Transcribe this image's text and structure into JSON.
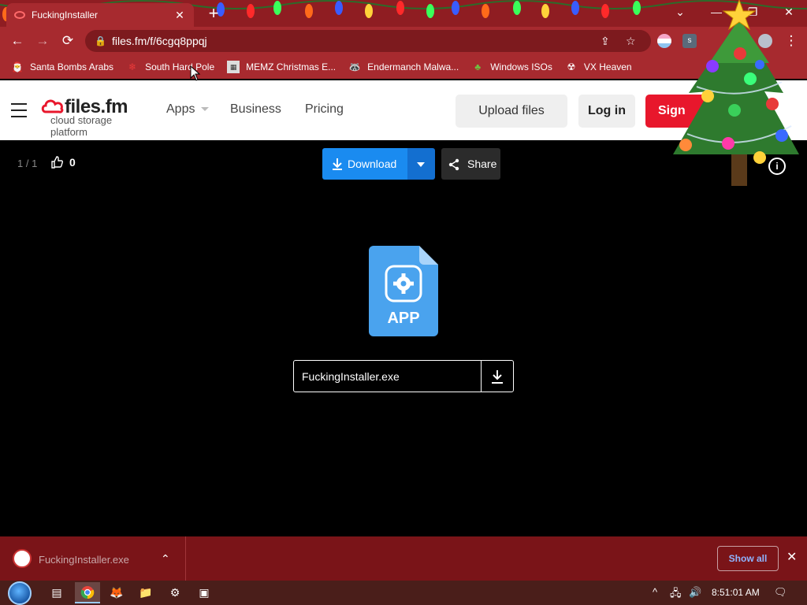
{
  "browser": {
    "tab_title": "FuckingInstaller",
    "tab_close": "✕",
    "new_tab": "+",
    "url": "files.fm/f/6cgq8ppqj",
    "window_controls": {
      "tab_search": "⌄",
      "minimize": "—",
      "maximize": "❐",
      "close": "✕"
    },
    "theme_colors": {
      "tabstrip": "#8f1d22",
      "toolbar": "#a72a2f",
      "shelf": "#7a1418"
    }
  },
  "bookmarks": [
    {
      "label": "Santa Bombs Arabs",
      "icon": "santa-icon"
    },
    {
      "label": "South Hard Pole",
      "icon": "snowflake-icon"
    },
    {
      "label": "MEMZ Christmas E...",
      "icon": "memz-icon"
    },
    {
      "label": "Endermanch Malwa...",
      "icon": "raccoon-icon"
    },
    {
      "label": "Windows ISOs",
      "icon": "tree-icon"
    },
    {
      "label": "VX Heaven",
      "icon": "vx-icon"
    }
  ],
  "site": {
    "logo_name": "files.fm",
    "logo_tagline": "cloud storage platform",
    "nav": {
      "apps": "Apps",
      "business": "Business",
      "pricing": "Pricing"
    },
    "upload_label": "Upload files",
    "login_label": "Log in",
    "signin_label": "Sign",
    "brand_color": "#e8172c"
  },
  "viewer": {
    "counter": "1 / 1",
    "likes": "0",
    "download_label": "Download",
    "share_label": "Share",
    "info_label": "i",
    "file_type_label": "APP",
    "file_name": "FuckingInstaller.exe",
    "accent_color": "#1a8bf0"
  },
  "shelf": {
    "file_name": "FuckingInstaller.exe",
    "chevron": "⌃",
    "show_all_label": "Show all",
    "close": "✕"
  },
  "taskbar": {
    "clock": "8:51:01 AM",
    "tray_chevron": "^",
    "network": "🖧",
    "volume": "🔊",
    "notifications": "🗨"
  }
}
